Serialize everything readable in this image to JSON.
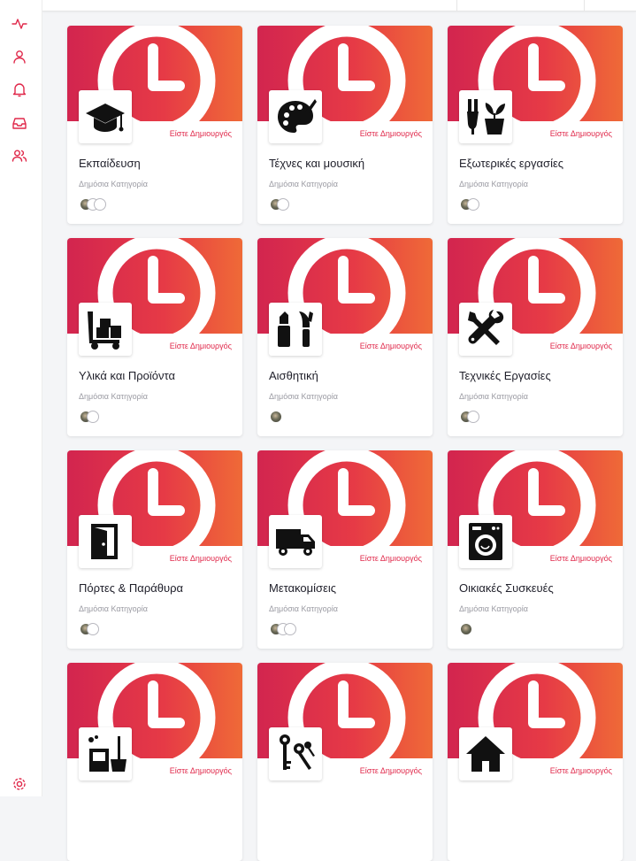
{
  "sidebar": {
    "icons": [
      "activity-icon",
      "user-icon",
      "bell-icon",
      "inbox-icon",
      "users-icon",
      "settings-icon"
    ],
    "accent": "#e0284a"
  },
  "cards": [
    {
      "title": "Εκπαίδευση",
      "subtitle": "Δημόσια Κατηγορία",
      "creator": "Είστε Δημιουργός",
      "icon": "graduation-cap-icon",
      "avatars": [
        "photo",
        "empty",
        "empty"
      ]
    },
    {
      "title": "Τέχνες και μουσική",
      "subtitle": "Δημόσια Κατηγορία",
      "creator": "Είστε Δημιουργός",
      "icon": "palette-icon",
      "avatars": [
        "photo",
        "empty"
      ]
    },
    {
      "title": "Εξωτερικές εργασίες",
      "subtitle": "Δημόσια Κατηγορία",
      "creator": "Είστε Δημιουργός",
      "icon": "gardening-icon",
      "avatars": [
        "photo",
        "empty"
      ]
    },
    {
      "title": "Υλικά και Προϊόντα",
      "subtitle": "Δημόσια Κατηγορία",
      "creator": "Είστε Δημιουργός",
      "icon": "hand-truck-icon",
      "avatars": [
        "photo",
        "empty"
      ]
    },
    {
      "title": "Αισθητική",
      "subtitle": "Δημόσια Κατηγορία",
      "creator": "Είστε Δημιουργός",
      "icon": "makeup-icon",
      "avatars": [
        "photo"
      ]
    },
    {
      "title": "Τεχνικές Εργασίες",
      "subtitle": "Δημόσια Κατηγορία",
      "creator": "Είστε Δημιουργός",
      "icon": "tools-icon",
      "avatars": [
        "photo",
        "empty"
      ]
    },
    {
      "title": "Πόρτες & Παράθυρα",
      "subtitle": "Δημόσια Κατηγορία",
      "creator": "Είστε Δημιουργός",
      "icon": "door-icon",
      "avatars": [
        "photo",
        "empty"
      ]
    },
    {
      "title": "Μετακομίσεις",
      "subtitle": "Δημόσια Κατηγορία",
      "creator": "Είστε Δημιουργός",
      "icon": "truck-icon",
      "avatars": [
        "photo",
        "empty",
        "empty"
      ]
    },
    {
      "title": "Οικιακές Συσκευές",
      "subtitle": "Δημόσια Κατηγορία",
      "creator": "Είστε Δημιουργός",
      "icon": "washing-machine-icon",
      "avatars": [
        "photo"
      ]
    },
    {
      "title": "",
      "subtitle": "",
      "creator": "Είστε Δημιουργός",
      "icon": "cleaning-icon",
      "avatars": []
    },
    {
      "title": "",
      "subtitle": "",
      "creator": "Είστε Δημιουργός",
      "icon": "keys-icon",
      "avatars": []
    },
    {
      "title": "",
      "subtitle": "",
      "creator": "Είστε Δημιουργός",
      "icon": "house-icon",
      "avatars": []
    }
  ]
}
